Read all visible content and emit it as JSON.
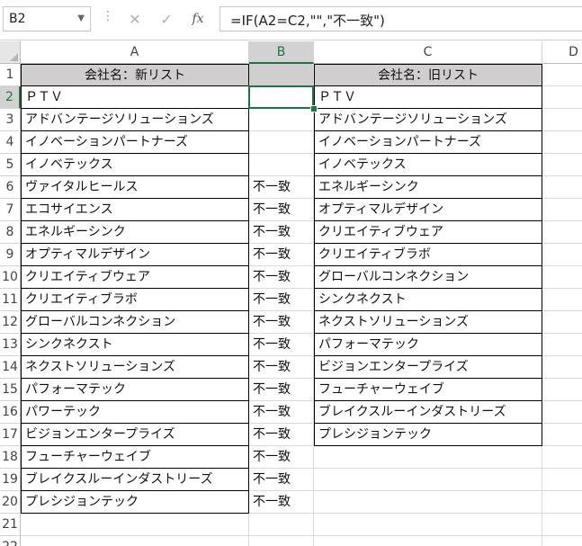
{
  "name_box": {
    "value": "B2"
  },
  "formula": {
    "value": "=IF(A2=C2,\"\",\"不一致\")"
  },
  "toolbar": {
    "cancel_icon": "cancel-icon",
    "enter_icon": "enter-icon",
    "fx_label": "fx"
  },
  "columns": [
    "A",
    "B",
    "C",
    "D"
  ],
  "rows": [
    "1",
    "2",
    "3",
    "4",
    "5",
    "6",
    "7",
    "8",
    "9",
    "10",
    "11",
    "12",
    "13",
    "14",
    "15",
    "16",
    "17",
    "18",
    "19",
    "20",
    "21",
    "22"
  ],
  "headers": {
    "a": "会社名：新リスト",
    "c": "会社名：旧リスト"
  },
  "col_a": [
    "ＰＴＶ",
    "アドバンテージソリューションズ",
    "イノベーションパートナーズ",
    "イノベテックス",
    "ヴァイタルヒールス",
    "エコサイエンス",
    "エネルギーシンク",
    "オプティマルデザイン",
    "クリエイティブウェア",
    "クリエイティブラボ",
    "グローバルコンネクション",
    "シンクネクスト",
    "ネクストソリューションズ",
    "パフォーマテック",
    "パワーテック",
    "ビジョンエンタープライズ",
    "フューチャーウェイブ",
    "ブレイクスルーインダストリーズ",
    "プレシジョンテック"
  ],
  "col_b": [
    "",
    "",
    "",
    "",
    "不一致",
    "不一致",
    "不一致",
    "不一致",
    "不一致",
    "不一致",
    "不一致",
    "不一致",
    "不一致",
    "不一致",
    "不一致",
    "不一致",
    "不一致",
    "不一致",
    "不一致"
  ],
  "col_c": [
    "ＰＴＶ",
    "アドバンテージソリューションズ",
    "イノベーションパートナーズ",
    "イノベテックス",
    "エネルギーシンク",
    "オプティマルデザイン",
    "クリエイティブウェア",
    "クリエイティブラボ",
    "グローバルコンネクション",
    "シンクネクスト",
    "ネクストソリューションズ",
    "パフォーマテック",
    "ビジョンエンタープライズ",
    "フューチャーウェイブ",
    "ブレイクスルーインダストリーズ",
    "プレシジョンテック"
  ],
  "colors": {
    "accent": "#217346",
    "header_fill": "#d0cece"
  }
}
